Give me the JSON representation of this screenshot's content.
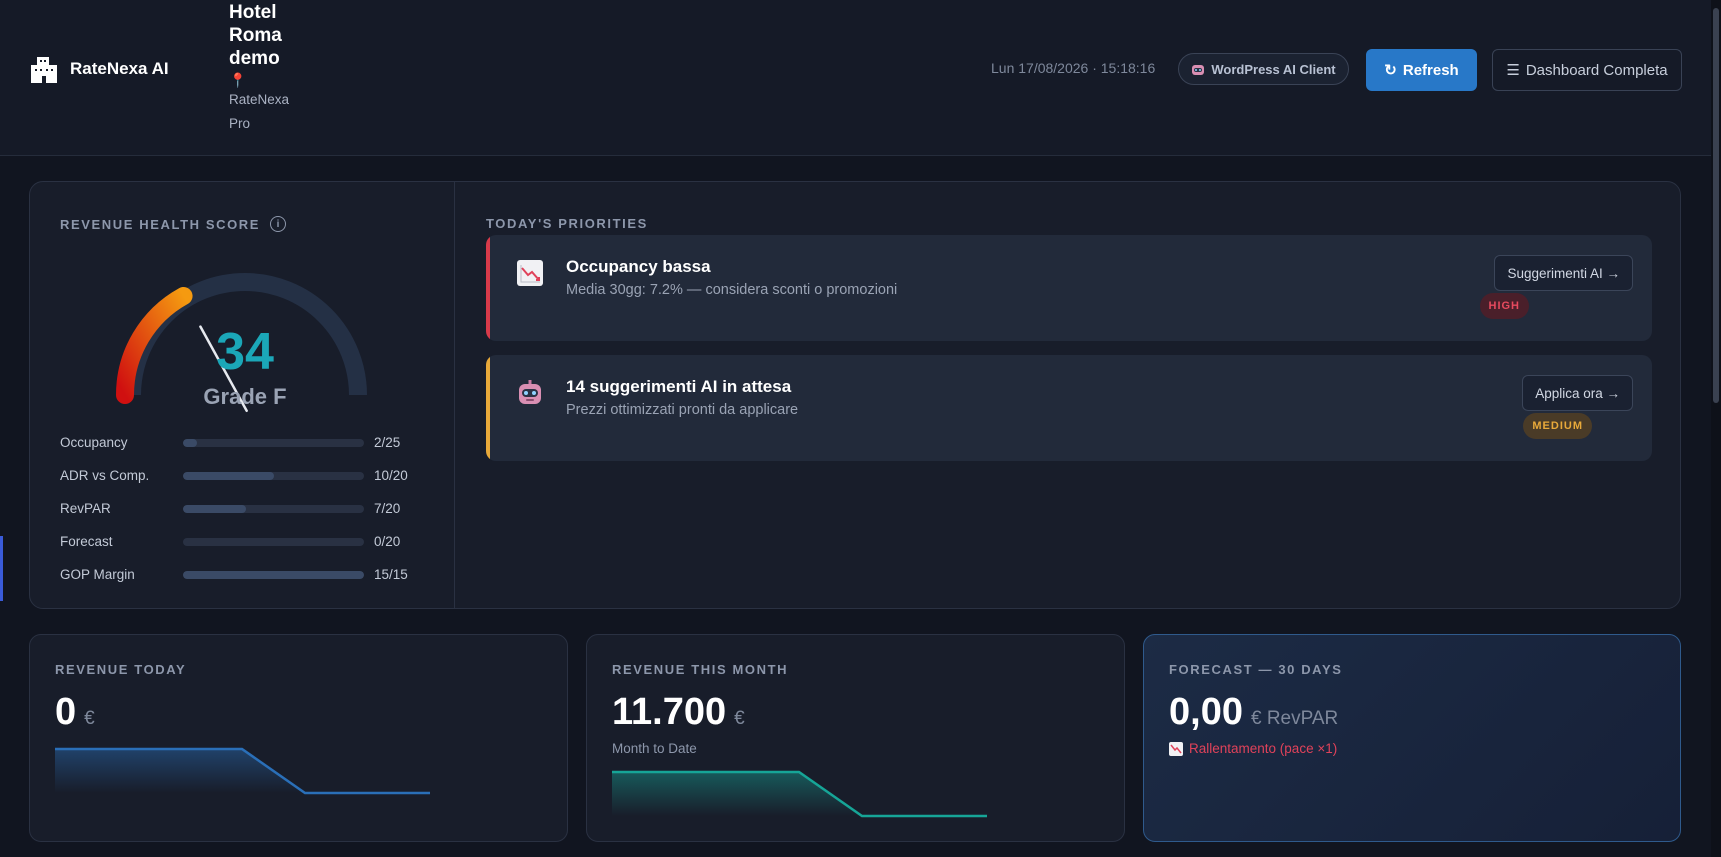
{
  "header": {
    "brand": "RateNexa AI",
    "hotel_name": "Hotel Roma demo",
    "hotel_pin": "📍",
    "plan": "RateNexa Pro",
    "datetime": "Lun 17/08/2026 · 15:18:16",
    "wp_client": "WordPress AI Client",
    "refresh": "Refresh",
    "dashboard": "Dashboard Completa"
  },
  "health": {
    "title": "REVENUE HEALTH SCORE",
    "info": "i",
    "score": "34",
    "grade": "Grade F",
    "score_fraction": 0.34,
    "metrics": [
      {
        "label": "Occupancy",
        "value": "2/25",
        "fill": 0.08
      },
      {
        "label": "ADR vs Comp.",
        "value": "10/20",
        "fill": 0.5
      },
      {
        "label": "RevPAR",
        "value": "7/20",
        "fill": 0.35
      },
      {
        "label": "Forecast",
        "value": "0/20",
        "fill": 0
      },
      {
        "label": "GOP Margin",
        "value": "15/15",
        "fill": 1
      }
    ]
  },
  "priorities": {
    "title": "TODAY'S PRIORITIES",
    "items": [
      {
        "title": "Occupancy bassa",
        "subtitle": "Media 30gg: 7.2% — considera sconti o promozioni",
        "action": "Suggerimenti AI →",
        "badge": "HIGH",
        "icon": "chart-down-icon",
        "accent": "#d83a4a"
      },
      {
        "title": "14 suggerimenti AI in attesa",
        "subtitle": "Prezzi ottimizzati pronti da applicare",
        "action": "Applica ora →",
        "badge": "MEDIUM",
        "icon": "robot-icon",
        "accent": "#e8a93a"
      }
    ]
  },
  "kpis": {
    "today": {
      "title": "REVENUE TODAY",
      "value": "0",
      "unit": "€"
    },
    "month": {
      "title": "REVENUE THIS MONTH",
      "value": "11.700",
      "unit": "€",
      "sub": "Month to Date"
    },
    "forecast": {
      "title": "FORECAST — 30 DAYS",
      "value": "0,00",
      "unit": "€ RevPAR",
      "trend": "Rallentamento (pace ×1)"
    }
  },
  "colors": {
    "accent": "#2878c8",
    "teal": "#1ba7b8",
    "danger": "#e0425a",
    "warning": "#e8a93a"
  }
}
